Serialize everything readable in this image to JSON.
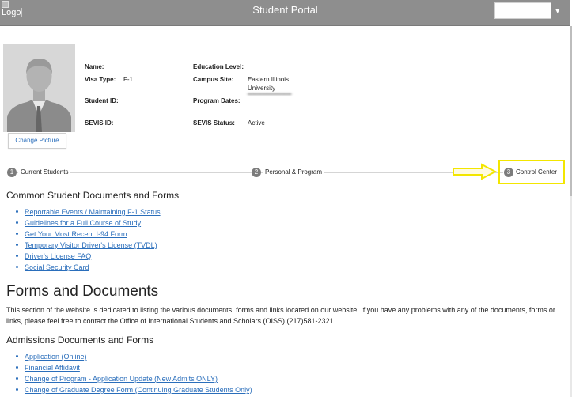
{
  "header": {
    "logo_alt": "Logo",
    "title": "Student Portal"
  },
  "profile": {
    "change_picture_label": "Change Picture",
    "fields": {
      "name_label": "Name:",
      "visa_type_label": "Visa Type:",
      "visa_type_value": "F-1",
      "student_id_label": "Student ID:",
      "sevis_id_label": "SEVIS ID:",
      "education_level_label": "Education Level:",
      "campus_site_label": "Campus Site:",
      "campus_site_value": "Eastern Illinois University",
      "program_dates_label": "Program Dates:",
      "sevis_status_label": "SEVIS Status:",
      "sevis_status_value": "Active"
    }
  },
  "steps": [
    {
      "number": "1",
      "label": "Current Students"
    },
    {
      "number": "2",
      "label": "Personal & Program"
    },
    {
      "number": "3",
      "label": "Control Center"
    }
  ],
  "annotation": {
    "color": "#f3e600"
  },
  "common_docs": {
    "heading": "Common Student Documents and Forms",
    "links": [
      "Reportable Events / Maintaining F-1 Status",
      "Guidelines for a Full Course of Study",
      "Get Your Most Recent I-94 Form",
      "Temporary Visitor Driver's License (TVDL)",
      "Driver's License FAQ",
      "Social Security Card"
    ]
  },
  "forms": {
    "heading": "Forms and Documents",
    "description": "This section of the website is dedicated to listing the various documents, forms and links located on our website. If you have any problems with any of the documents, forms or links, please feel free to contact the Office of International Students and Scholars (OISS) (217)581-2321."
  },
  "admissions": {
    "heading": "Admissions Documents and Forms",
    "links": [
      "Application (Online)",
      "Financial Affidavit",
      "Change of Program - Application Update (New Admits ONLY)",
      "Change of Graduate Degree Form (Continuing Graduate Students Only)"
    ]
  },
  "colors": {
    "topbar": "#8e8e8e",
    "link": "#2a6ebb",
    "step_circle": "#7c7c7c"
  }
}
